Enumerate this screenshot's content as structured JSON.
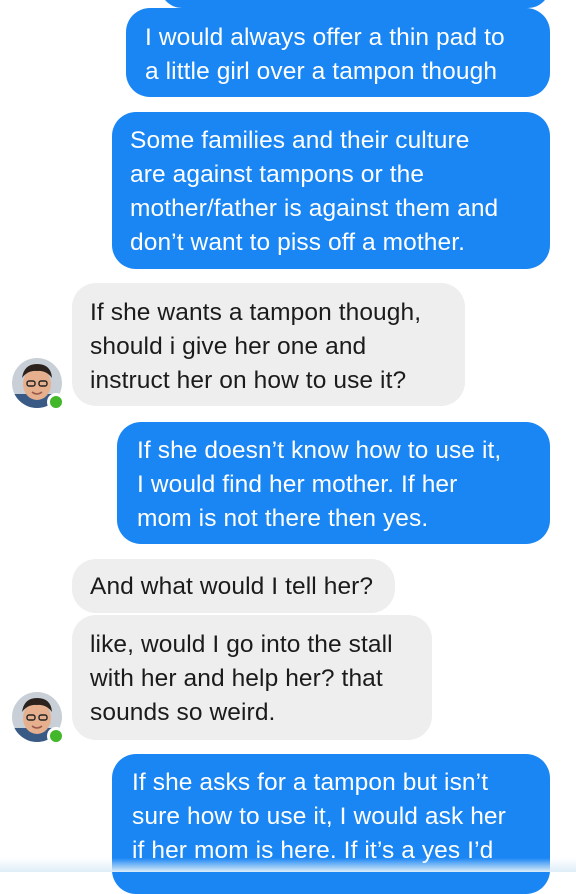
{
  "messages": [
    {
      "id": "m1",
      "side": "out",
      "text": "I would always offer a thin pad to\na little girl over a tampon though"
    },
    {
      "id": "m2",
      "side": "out",
      "text": "Some families and their culture\nare against tampons or the\nmother/father is against them and\ndon’t want to piss off a mother."
    },
    {
      "id": "m3",
      "side": "in",
      "text": "If she wants a tampon though,\nshould i give her one and\ninstruct her on how to use it?"
    },
    {
      "id": "m4",
      "side": "out",
      "text": "If she doesn’t know how to use it,\nI would find her mother. If her\nmom is not there then yes."
    },
    {
      "id": "m5",
      "side": "in",
      "text": "And what would I tell her?"
    },
    {
      "id": "m6",
      "side": "in",
      "text": "like, would I go into the stall\nwith her and help her? that\nsounds so weird."
    },
    {
      "id": "m7",
      "side": "out",
      "text": "If she asks for a tampon but isn’t\nsure how to use it, I would ask her\nif her mom is here. If it’s a yes I’d"
    }
  ],
  "avatar": {
    "icon": "user-avatar-icon",
    "status": "online"
  },
  "colors": {
    "outgoing_bubble": "#1a86f4",
    "incoming_bubble": "#eeeeef",
    "online_dot": "#42b72a"
  }
}
